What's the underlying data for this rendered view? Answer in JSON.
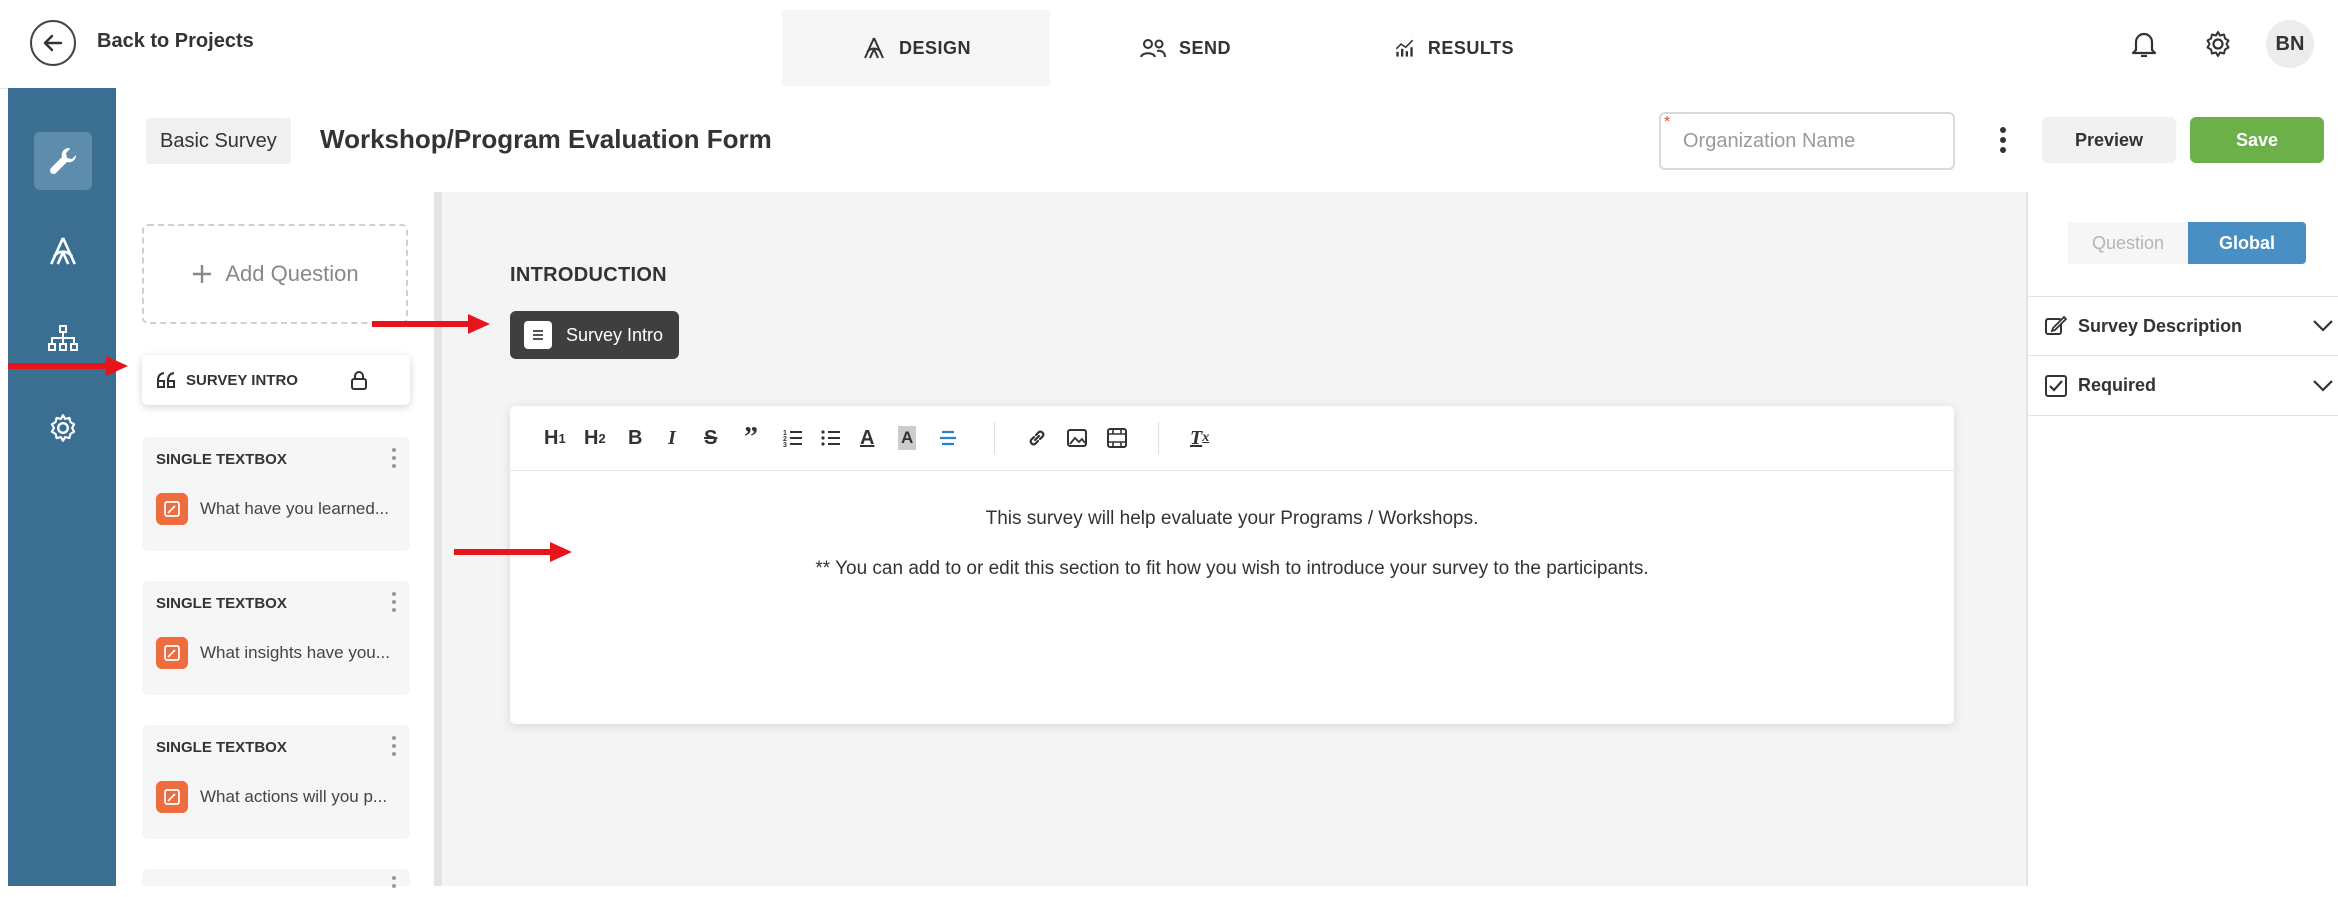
{
  "header": {
    "back_label": "Back to Projects",
    "tabs": [
      {
        "label": "DESIGN",
        "icon": "design-icon",
        "active": true
      },
      {
        "label": "SEND",
        "icon": "users-icon",
        "active": false
      },
      {
        "label": "RESULTS",
        "icon": "chart-icon",
        "active": false
      }
    ],
    "avatar_initials": "BN"
  },
  "sidebar": {
    "items": [
      {
        "icon": "wrench-icon",
        "active": true
      },
      {
        "icon": "design-icon",
        "active": false
      },
      {
        "icon": "sitemap-icon",
        "active": false
      },
      {
        "icon": "gear-icon",
        "active": false
      }
    ]
  },
  "subheader": {
    "survey_type": "Basic Survey",
    "form_title": "Workshop/Program Evaluation Form",
    "org_placeholder": "Organization Name",
    "org_required_mark": "*",
    "preview_label": "Preview",
    "save_label": "Save"
  },
  "question_panel": {
    "add_question_label": "Add Question",
    "intro_item_label": "SURVEY INTRO",
    "questions": [
      {
        "type": "SINGLE TEXTBOX",
        "text": "What have you learned..."
      },
      {
        "type": "SINGLE TEXTBOX",
        "text": "What insights have you..."
      },
      {
        "type": "SINGLE TEXTBOX",
        "text": "What actions will you p..."
      }
    ]
  },
  "canvas": {
    "section_label": "INTRODUCTION",
    "intro_pill_label": "Survey Intro",
    "editor": {
      "toolbar": [
        "H1",
        "H2",
        "B",
        "I",
        "S",
        "”",
        "ordered-list",
        "bullet-list",
        "A",
        "A",
        "align",
        "link",
        "image",
        "video",
        "Tx"
      ],
      "line1": "This survey will help evaluate your Programs / Workshops.",
      "line2": "** You can add to or edit this section to fit how you wish to introduce your survey to the participants."
    }
  },
  "right_panel": {
    "toggle": {
      "question_label": "Question",
      "global_label": "Global",
      "selected": "Global"
    },
    "sections": [
      {
        "label": "Survey Description",
        "icon": "edit-icon"
      },
      {
        "label": "Required",
        "icon": "checkbox-icon"
      }
    ]
  },
  "colors": {
    "sidebar": "#3b6f92",
    "save": "#6cb04a",
    "global_toggle": "#4a8fc3",
    "question_icon": "#ef6c3e",
    "annotation_arrow": "#e8141c"
  }
}
